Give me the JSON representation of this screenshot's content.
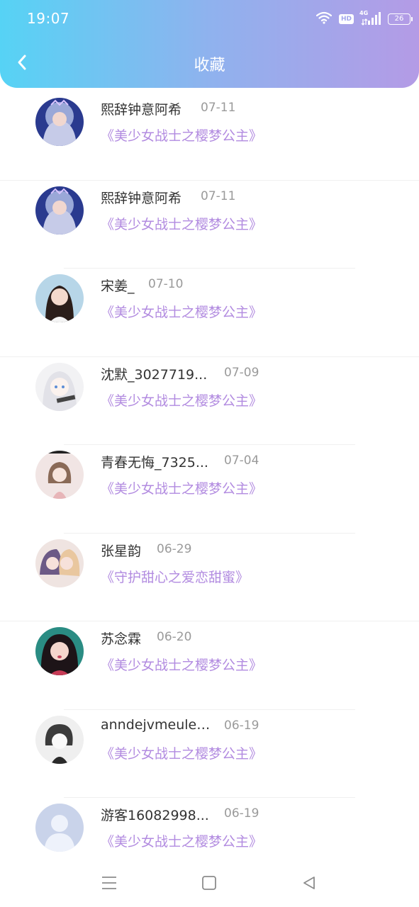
{
  "status_bar": {
    "time": "19:07",
    "network_label": "4G",
    "hd_label": "HD",
    "battery_level": "26"
  },
  "header": {
    "title": "收藏",
    "gradient": [
      "#56d3f5",
      "#b49be6"
    ]
  },
  "favorites": [
    {
      "name": "熙辞钟意阿希",
      "date": "07-11",
      "work": "《美少女战士之樱梦公主》",
      "avatar": "avatar-anime-princess"
    },
    {
      "name": "熙辞钟意阿希",
      "date": "07-11",
      "work": "《美少女战士之樱梦公主》",
      "avatar": "avatar-anime-princess"
    },
    {
      "name": "宋姜_",
      "date": "07-10",
      "work": "《美少女战士之樱梦公主》",
      "avatar": "avatar-girl-photo"
    },
    {
      "name": "沈默_3027719...",
      "date": "07-09",
      "work": "《美少女战士之樱梦公主》",
      "avatar": "avatar-white-anime"
    },
    {
      "name": "青春无悔_7325...",
      "date": "07-04",
      "work": "《美少女战士之樱梦公主》",
      "avatar": "avatar-chibi-girl"
    },
    {
      "name": "张星韵",
      "date": "06-29",
      "work": "《守护甜心之爱恋甜蜜》",
      "avatar": "avatar-anime-couple"
    },
    {
      "name": "苏念霖",
      "date": "06-20",
      "work": "《美少女战士之樱梦公主》",
      "avatar": "avatar-idol-girl"
    },
    {
      "name": "anndejvmeulec...",
      "date": "06-19",
      "work": "《美少女战士之樱梦公主》",
      "avatar": "avatar-sketch-boy"
    },
    {
      "name": "游客16082998...",
      "date": "06-19",
      "work": "《美少女战士之樱梦公主》",
      "avatar": "avatar-default-user"
    }
  ],
  "colors": {
    "work_title": "#b28be0",
    "name": "#333333",
    "date": "#9a9a9a"
  }
}
